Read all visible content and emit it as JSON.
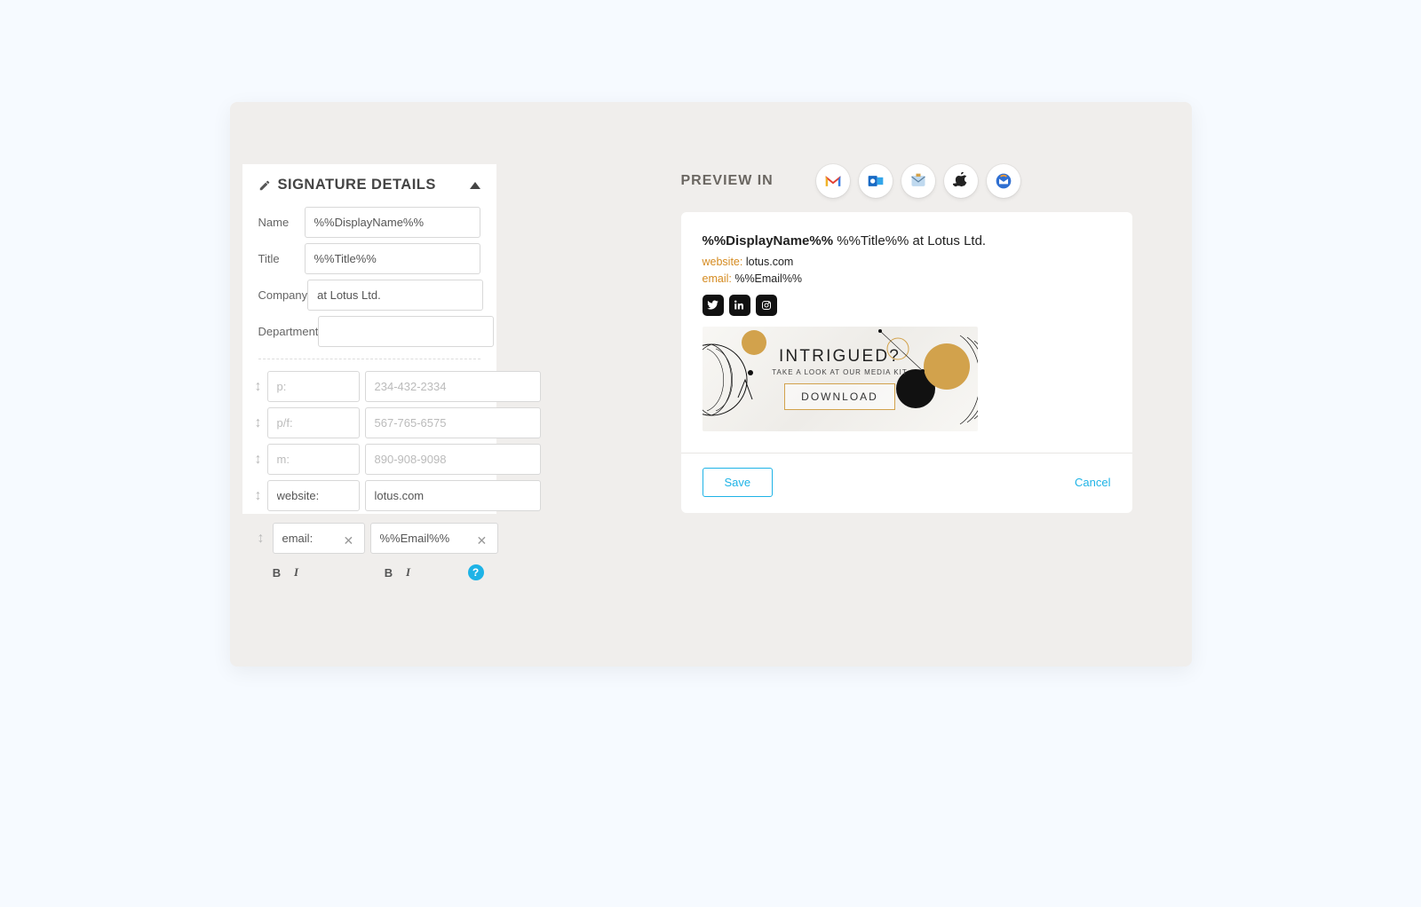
{
  "panel": {
    "title": "SIGNATURE DETAILS",
    "fields": {
      "name_label": "Name",
      "name_value": "%%DisplayName%%",
      "title_label": "Title",
      "title_value": "%%Title%%",
      "company_label": "Company",
      "company_value": "at Lotus Ltd.",
      "department_label": "Department",
      "department_value": ""
    },
    "contacts": [
      {
        "label_placeholder": "p:",
        "label": "",
        "value_placeholder": "234-432-2334",
        "value": ""
      },
      {
        "label_placeholder": "p/f:",
        "label": "",
        "value_placeholder": "567-765-6575",
        "value": ""
      },
      {
        "label_placeholder": "m:",
        "label": "",
        "value_placeholder": "890-908-9098",
        "value": ""
      },
      {
        "label_placeholder": "",
        "label": "website:",
        "value_placeholder": "",
        "value": "lotus.com"
      },
      {
        "label_placeholder": "",
        "label": "email:",
        "value_placeholder": "",
        "value": "%%Email%%",
        "active": true
      }
    ],
    "help_label": "?"
  },
  "preview": {
    "header_label": "PREVIEW IN",
    "clients": [
      "gmail",
      "outlook",
      "applemail",
      "apple",
      "thunderbird"
    ],
    "signature": {
      "display_name": "%%DisplayName%%",
      "title_line_suffix": "%%Title%% at Lotus Ltd.",
      "website_key": "website:",
      "website_val": "lotus.com",
      "email_key": "email:",
      "email_val": "%%Email%%"
    },
    "banner": {
      "title": "INTRIGUED?",
      "subtitle": "TAKE A LOOK AT OUR MEDIA KIT",
      "cta": "DOWNLOAD"
    },
    "actions": {
      "save": "Save",
      "cancel": "Cancel"
    }
  }
}
